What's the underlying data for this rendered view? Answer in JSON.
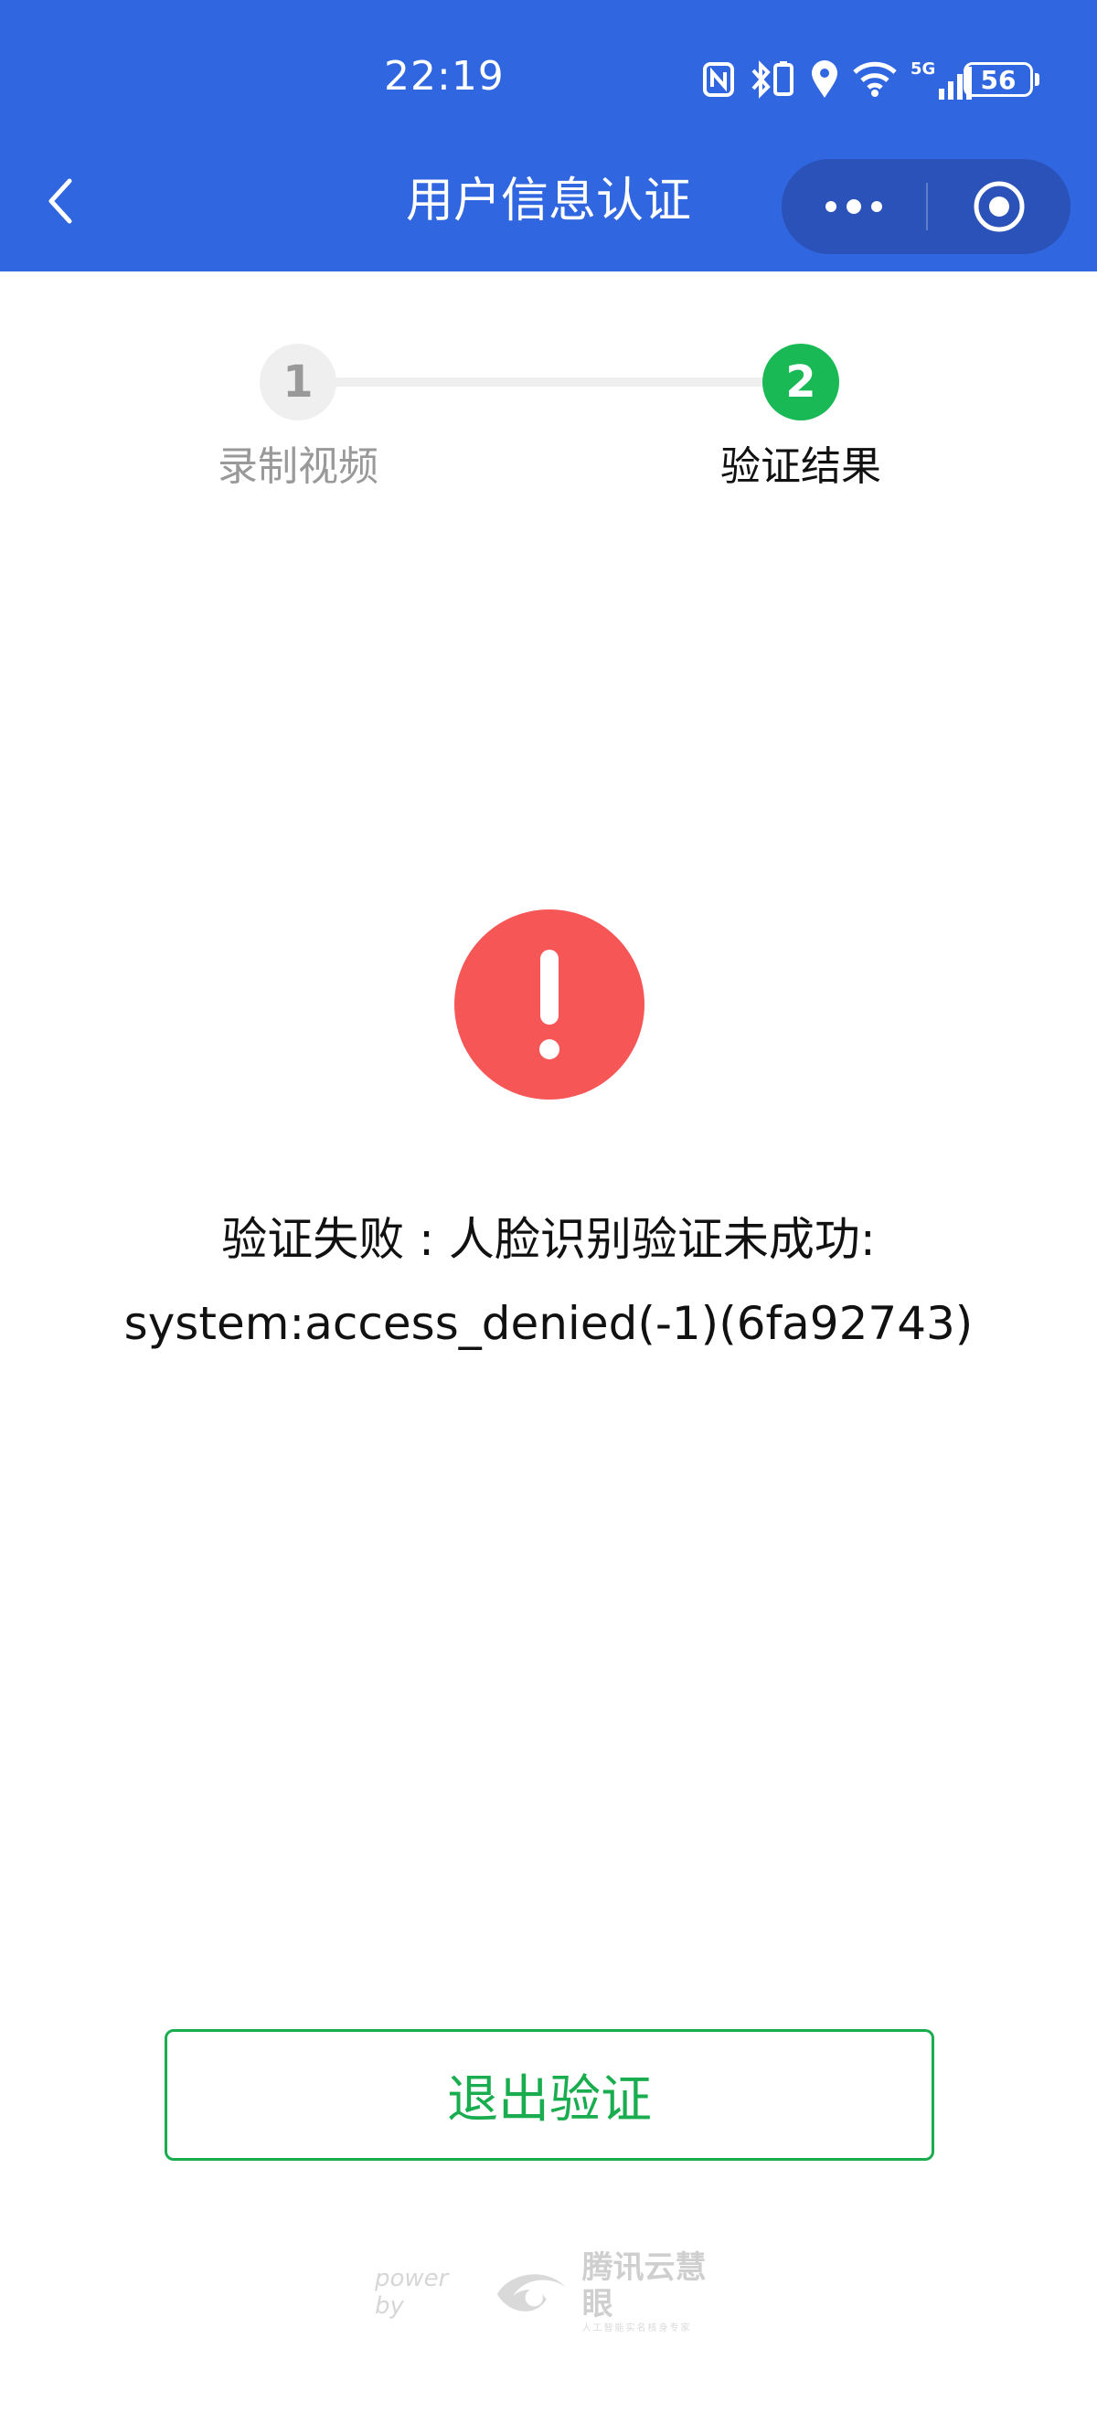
{
  "status_bar": {
    "time": "22:19",
    "network": "5G",
    "battery": "56"
  },
  "nav": {
    "title": "用户信息认证"
  },
  "steps": [
    {
      "number": "1",
      "label": "录制视频"
    },
    {
      "number": "2",
      "label": "验证结果"
    }
  ],
  "result": {
    "line1": "验证失败 : 人脸识别验证未成功:",
    "line2": "system:access_denied(-1)(6fa92743)"
  },
  "exit_button": {
    "label": "退出验证"
  },
  "footer": {
    "power_by": "power by",
    "brand_name": "腾讯云慧眼",
    "brand_sub": "人工智能实名核身专家"
  },
  "colors": {
    "header_bg": "#3066E0",
    "capsule_bg": "#2A52B8",
    "active_step": "#19B955",
    "error": "#F65656",
    "button_border": "#1AAD4F"
  }
}
